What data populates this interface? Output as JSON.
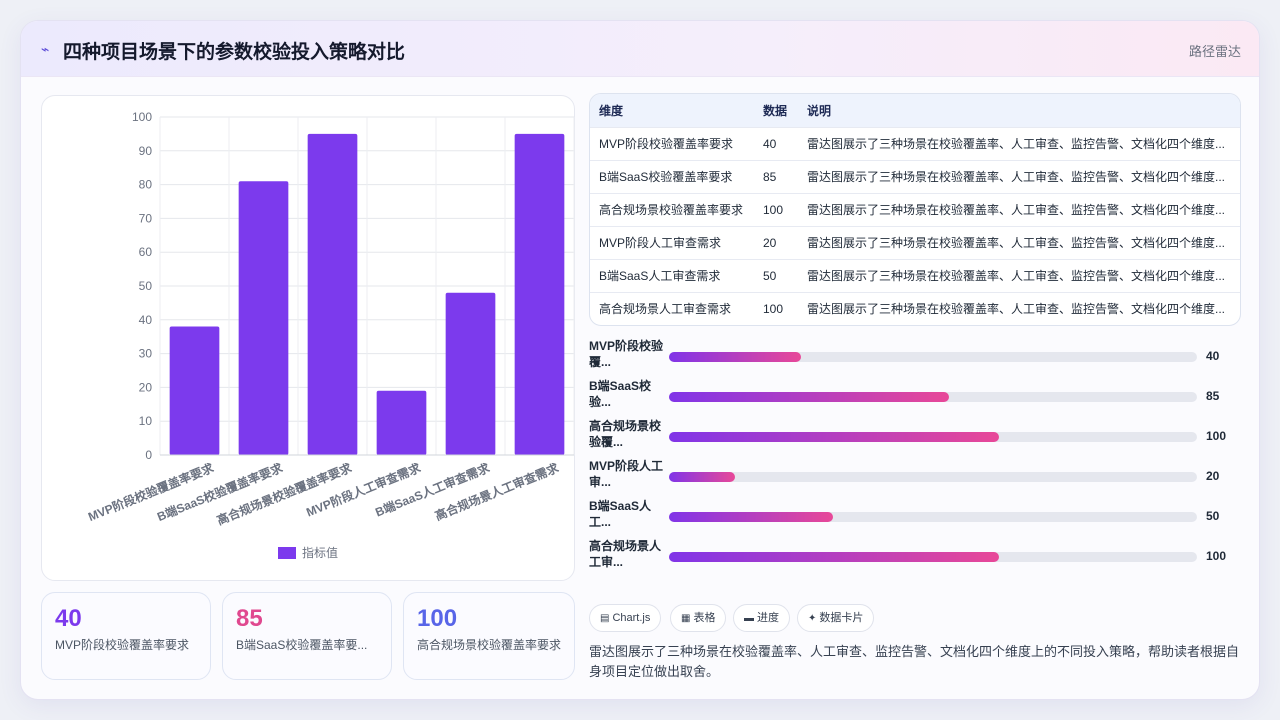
{
  "header": {
    "icon": "chart-line-icon",
    "title": "四种项目场景下的参数校验投入策略对比",
    "right_label": "路径雷达"
  },
  "chart_data": {
    "type": "bar",
    "categories": [
      "MVP阶段校验覆盖率要求",
      "B端SaaS校验覆盖率要求",
      "高合规场景校验覆盖率要求",
      "MVP阶段人工审查需求",
      "B端SaaS人工审查需求",
      "高合规场景人工审查需求"
    ],
    "series": [
      {
        "name": "指标值",
        "values": [
          38,
          81,
          95,
          19,
          48,
          95
        ]
      }
    ],
    "ylim": [
      0,
      100
    ],
    "yticks": [
      "0",
      "10",
      "20",
      "30",
      "40",
      "50",
      "60",
      "70",
      "80",
      "90",
      "100"
    ],
    "grid": true,
    "legend": "bottom",
    "colors": {
      "bar": "#7c3aed"
    }
  },
  "stats": [
    {
      "value": "40",
      "label": "MVP阶段校验覆盖率要求",
      "color": "#7c3aed"
    },
    {
      "value": "85",
      "label": "B端SaaS校验覆盖率要...",
      "color": "#e0488f"
    },
    {
      "value": "100",
      "label": "高合规场景校验覆盖率要求",
      "color": "#5865e8"
    }
  ],
  "table": {
    "headers": [
      "维度",
      "数据",
      "说明"
    ],
    "rows": [
      [
        "MVP阶段校验覆盖率要求",
        "40",
        "雷达图展示了三种场景在校验覆盖率、人工审查、监控告警、文档化四个维度..."
      ],
      [
        "B端SaaS校验覆盖率要求",
        "85",
        "雷达图展示了三种场景在校验覆盖率、人工审查、监控告警、文档化四个维度..."
      ],
      [
        "高合规场景校验覆盖率要求",
        "100",
        "雷达图展示了三种场景在校验覆盖率、人工审查、监控告警、文档化四个维度..."
      ],
      [
        "MVP阶段人工审查需求",
        "20",
        "雷达图展示了三种场景在校验覆盖率、人工审查、监控告警、文档化四个维度..."
      ],
      [
        "B端SaaS人工审查需求",
        "50",
        "雷达图展示了三种场景在校验覆盖率、人工审查、监控告警、文档化四个维度..."
      ],
      [
        "高合规场景人工审查需求",
        "100",
        "雷达图展示了三种场景在校验覆盖率、人工审查、监控告警、文档化四个维度..."
      ]
    ]
  },
  "progress": [
    {
      "label": "MVP阶段校验覆...",
      "value": "40",
      "fraction": 0.25
    },
    {
      "label": "B端SaaS校验...",
      "value": "85",
      "fraction": 0.53
    },
    {
      "label": "高合规场景校验覆...",
      "value": "100",
      "fraction": 0.625
    },
    {
      "label": "MVP阶段人工审...",
      "value": "20",
      "fraction": 0.125
    },
    {
      "label": "B端SaaS人工...",
      "value": "50",
      "fraction": 0.31
    },
    {
      "label": "高合规场景人工审...",
      "value": "100",
      "fraction": 0.625
    }
  ],
  "chips": [
    {
      "icon": "table-icon",
      "label": "Chart.js"
    },
    {
      "icon": "grid-icon",
      "label": "表格"
    },
    {
      "icon": "progress-icon",
      "label": "进度"
    },
    {
      "icon": "sparkle-icon",
      "label": "数据卡片"
    }
  ],
  "description": "雷达图展示了三种场景在校验覆盖率、人工审查、监控告警、文档化四个维度上的不同投入策略，帮助读者根据自身项目定位做出取舍。"
}
